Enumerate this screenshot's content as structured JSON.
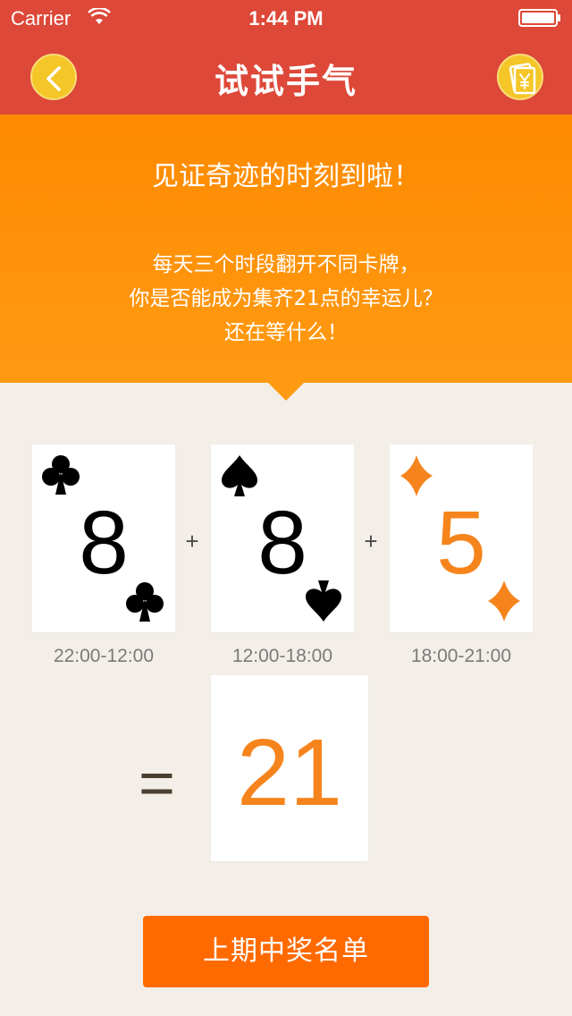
{
  "status_bar": {
    "carrier": "Carrier",
    "time": "1:44 PM"
  },
  "nav": {
    "title": "试试手气",
    "back_icon": "chevron-left-icon",
    "wallet_icon": "yen-card-icon"
  },
  "banner": {
    "headline": "见证奇迹的时刻到啦！",
    "lines": [
      "每天三个时段翻开不同卡牌，",
      "你是否能成为集齐21点的幸运儿？",
      "还在等什么！"
    ]
  },
  "cards": [
    {
      "value": "8",
      "suit": "club",
      "color": "#000000",
      "time": "22:00-12:00"
    },
    {
      "value": "8",
      "suit": "spade",
      "color": "#000000",
      "time": "12:00-18:00"
    },
    {
      "value": "5",
      "suit": "diamond",
      "color": "#f6841c",
      "time": "18:00-21:00"
    }
  ],
  "operators": {
    "plus": "+",
    "equals": "="
  },
  "result": {
    "value": "21",
    "color": "#f6841c"
  },
  "winners_button": {
    "label": "上期中奖名单"
  },
  "colors": {
    "header": "#dd4838",
    "banner": "#fe8a00",
    "button": "#ff6a00",
    "accent": "#f4c627"
  }
}
